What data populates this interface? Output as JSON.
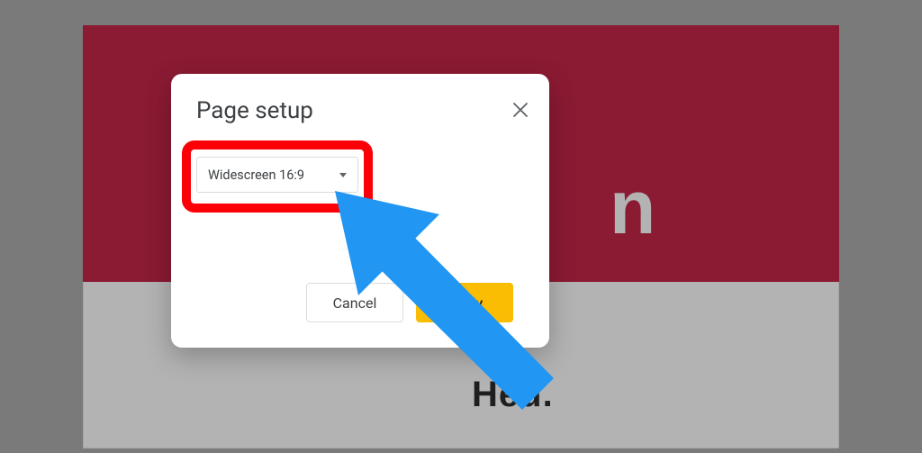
{
  "background": {
    "big_letter": "n",
    "cropped_word": "Heu."
  },
  "dialog": {
    "title": "Page setup",
    "dropdown": {
      "selected": "Widescreen 16:9"
    },
    "buttons": {
      "cancel": "Cancel",
      "apply": "Apply"
    }
  },
  "annotation": {
    "highlight_target": "aspect-ratio-dropdown",
    "arrow_color": "#2196f3"
  }
}
